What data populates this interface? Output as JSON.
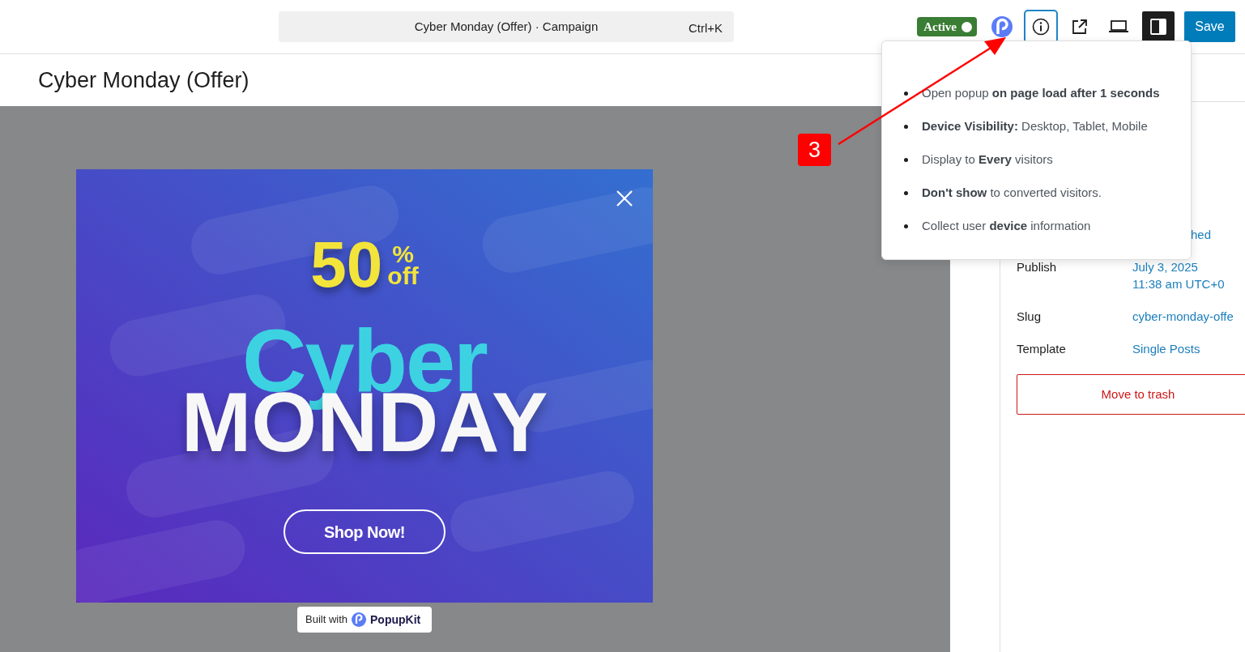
{
  "topbar": {
    "command_bar": {
      "title": "Cyber Monday (Offer) · Campaign",
      "shortcut": "Ctrl+K"
    },
    "status_toggle": {
      "label": "Active",
      "on": true
    },
    "toolbar": [
      {
        "kind": "logo",
        "focused": false,
        "pressed": false
      },
      {
        "kind": "info",
        "focused": true,
        "pressed": false
      },
      {
        "kind": "external",
        "focused": false,
        "pressed": false
      },
      {
        "kind": "device",
        "focused": false,
        "pressed": false
      },
      {
        "kind": "sidebar",
        "focused": false,
        "pressed": true
      }
    ],
    "save": "Save"
  },
  "page_title": "Cyber Monday (Offer)",
  "popup": {
    "discount_number": "50",
    "discount_percent": "%",
    "discount_off": "off",
    "headline_1": "Cyber",
    "headline_2": "MONDAY",
    "button": "Shop Now!"
  },
  "branding": {
    "prefix": "Built with",
    "brand": "PopupKit"
  },
  "sidebar": {
    "rows": [
      {
        "value_lines": [
          "hed"
        ]
      },
      {
        "label": "Publish",
        "value_lines": [
          "July 3, 2025",
          "11:38 am UTC+0"
        ]
      },
      {
        "label": "Slug",
        "value_lines": [
          "cyber-monday-offe"
        ]
      },
      {
        "label": "Template",
        "value_lines": [
          "Single Posts"
        ]
      }
    ],
    "trash_button": "Move to trash"
  },
  "info_popover": {
    "items": [
      "Open popup **on page load after 1 seconds**",
      "**Device Visibility:** Desktop, Tablet, Mobile",
      "Display to **Every** visitors",
      "**Don't show** to converted visitors.",
      "Collect user **device** information"
    ]
  },
  "annotation": {
    "step": "3"
  }
}
